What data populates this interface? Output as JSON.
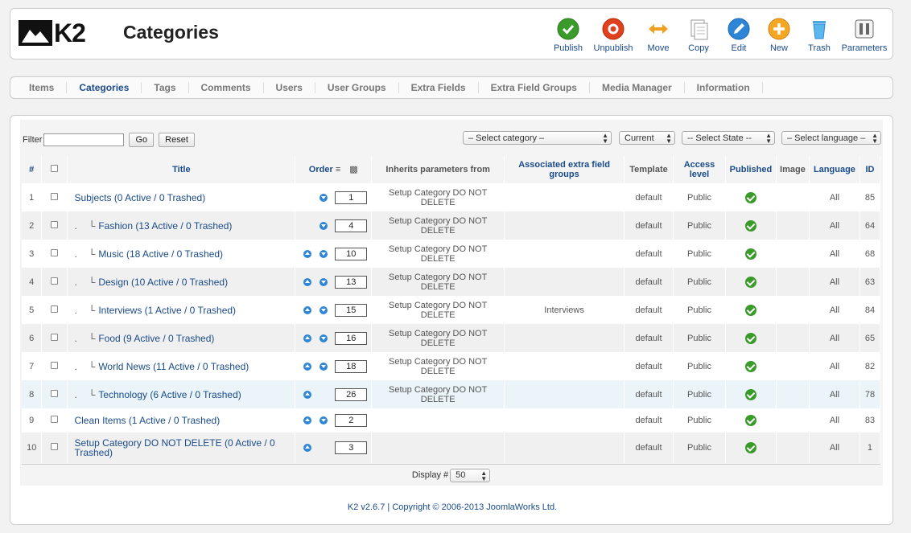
{
  "app": {
    "logo_text": "K2",
    "page_title": "Categories"
  },
  "toolbar": [
    {
      "label": "Publish",
      "icon": "publish-icon"
    },
    {
      "label": "Unpublish",
      "icon": "unpublish-icon"
    },
    {
      "label": "Move",
      "icon": "move-icon"
    },
    {
      "label": "Copy",
      "icon": "copy-icon"
    },
    {
      "label": "Edit",
      "icon": "edit-icon"
    },
    {
      "label": "New",
      "icon": "new-icon"
    },
    {
      "label": "Trash",
      "icon": "trash-icon"
    },
    {
      "label": "Parameters",
      "icon": "parameters-icon"
    }
  ],
  "tabs": [
    "Items",
    "Categories",
    "Tags",
    "Comments",
    "Users",
    "User Groups",
    "Extra Fields",
    "Extra Field Groups",
    "Media Manager",
    "Information"
  ],
  "active_tab": "Categories",
  "filter": {
    "label": "Filter",
    "value": "",
    "go": "Go",
    "reset": "Reset"
  },
  "selects": {
    "category": "– Select category –",
    "current": "Current",
    "state": "-- Select State --",
    "language": "– Select language –"
  },
  "columns": [
    "#",
    "Title",
    "Order",
    "Inherits parameters from",
    "Associated extra field groups",
    "Template",
    "Access level",
    "Published",
    "Image",
    "Language",
    "ID"
  ],
  "rows": [
    {
      "num": "1",
      "dot": "",
      "title": "Subjects (0 Active / 0 Trashed)",
      "up": false,
      "down": true,
      "order": "1",
      "inherit": "Setup Category DO NOT DELETE",
      "extra": "",
      "template": "default",
      "access": "Public",
      "language": "All",
      "id": "85"
    },
    {
      "num": "2",
      "dot": ".",
      "title": "Fashion (13 Active / 0 Trashed)",
      "up": false,
      "down": true,
      "order": "4",
      "inherit": "Setup Category DO NOT DELETE",
      "extra": "",
      "template": "default",
      "access": "Public",
      "language": "All",
      "id": "64"
    },
    {
      "num": "3",
      "dot": ".",
      "title": "Music (18 Active / 0 Trashed)",
      "up": true,
      "down": true,
      "order": "10",
      "inherit": "Setup Category DO NOT DELETE",
      "extra": "",
      "template": "default",
      "access": "Public",
      "language": "All",
      "id": "68"
    },
    {
      "num": "4",
      "dot": ".",
      "title": "Design (10 Active / 0 Trashed)",
      "up": true,
      "down": true,
      "order": "13",
      "inherit": "Setup Category DO NOT DELETE",
      "extra": "",
      "template": "default",
      "access": "Public",
      "language": "All",
      "id": "63"
    },
    {
      "num": "5",
      "dot": ".",
      "title": "Interviews (1 Active / 0 Trashed)",
      "up": true,
      "down": true,
      "order": "15",
      "inherit": "Setup Category DO NOT DELETE",
      "extra": "Interviews",
      "template": "default",
      "access": "Public",
      "language": "All",
      "id": "84"
    },
    {
      "num": "6",
      "dot": ".",
      "title": "Food (9 Active / 0 Trashed)",
      "up": true,
      "down": true,
      "order": "16",
      "inherit": "Setup Category DO NOT DELETE",
      "extra": "",
      "template": "default",
      "access": "Public",
      "language": "All",
      "id": "65"
    },
    {
      "num": "7",
      "dot": ".",
      "title": "World News (11 Active / 0 Trashed)",
      "up": true,
      "down": true,
      "order": "18",
      "inherit": "Setup Category DO NOT DELETE",
      "extra": "",
      "template": "default",
      "access": "Public",
      "language": "All",
      "id": "82"
    },
    {
      "num": "8",
      "dot": ".",
      "title": "Technology (6 Active / 0 Trashed)",
      "up": true,
      "down": false,
      "order": "26",
      "inherit": "Setup Category DO NOT DELETE",
      "extra": "",
      "template": "default",
      "access": "Public",
      "language": "All",
      "id": "78"
    },
    {
      "num": "9",
      "dot": "",
      "title": "Clean Items (1 Active / 0 Trashed)",
      "up": true,
      "down": true,
      "order": "2",
      "inherit": "",
      "extra": "",
      "template": "default",
      "access": "Public",
      "language": "All",
      "id": "83"
    },
    {
      "num": "10",
      "dot": "",
      "title": "Setup Category DO NOT DELETE (0 Active / 0 Trashed)",
      "up": true,
      "down": false,
      "order": "3",
      "inherit": "",
      "extra": "",
      "template": "default",
      "access": "Public",
      "language": "All",
      "id": "1"
    }
  ],
  "display": {
    "label": "Display #",
    "value": "50"
  },
  "footer": {
    "version": "K2 v2.6.7",
    "copyright": "| Copyright © 2006-2013 JoomlaWorks Ltd."
  },
  "colors": {
    "link": "#1a4b8a",
    "published": "#3a9a2a",
    "order_arrow": "#2d85d6"
  }
}
